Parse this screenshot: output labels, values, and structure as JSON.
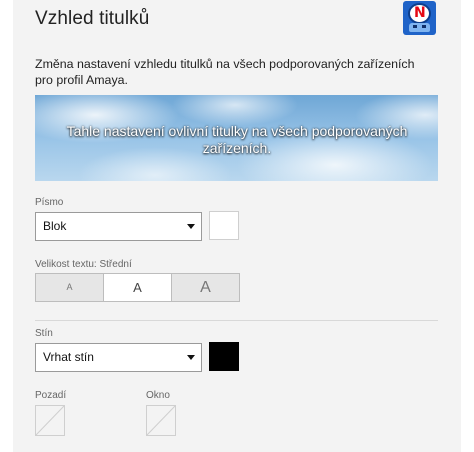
{
  "header": {
    "title": "Vzhled titulků",
    "avatar_icon": "profile-avatar-icon"
  },
  "description": "Změna nastavení vzhledu titulků na všech podporovaných zařízeních pro profil Amaya.",
  "preview": {
    "subtitle_text": "Tahle nastavení ovlivní titulky na všech podporovaných zařízeních."
  },
  "font": {
    "label": "Písmo",
    "selected": "Blok",
    "color": "#ffffff"
  },
  "text_size": {
    "label": "Velikost textu: Střední",
    "options": [
      "A",
      "A",
      "A"
    ],
    "selected_index": 1
  },
  "shadow": {
    "label": "Stín",
    "selected": "Vrhat stín",
    "color": "#000000"
  },
  "background": {
    "label": "Pozadí",
    "icon": "none-slash-icon"
  },
  "window": {
    "label": "Okno",
    "icon": "none-slash-icon"
  },
  "colors": {
    "panel_bg": "#f3f3f3",
    "accent_avatar": "#1f63c8"
  }
}
